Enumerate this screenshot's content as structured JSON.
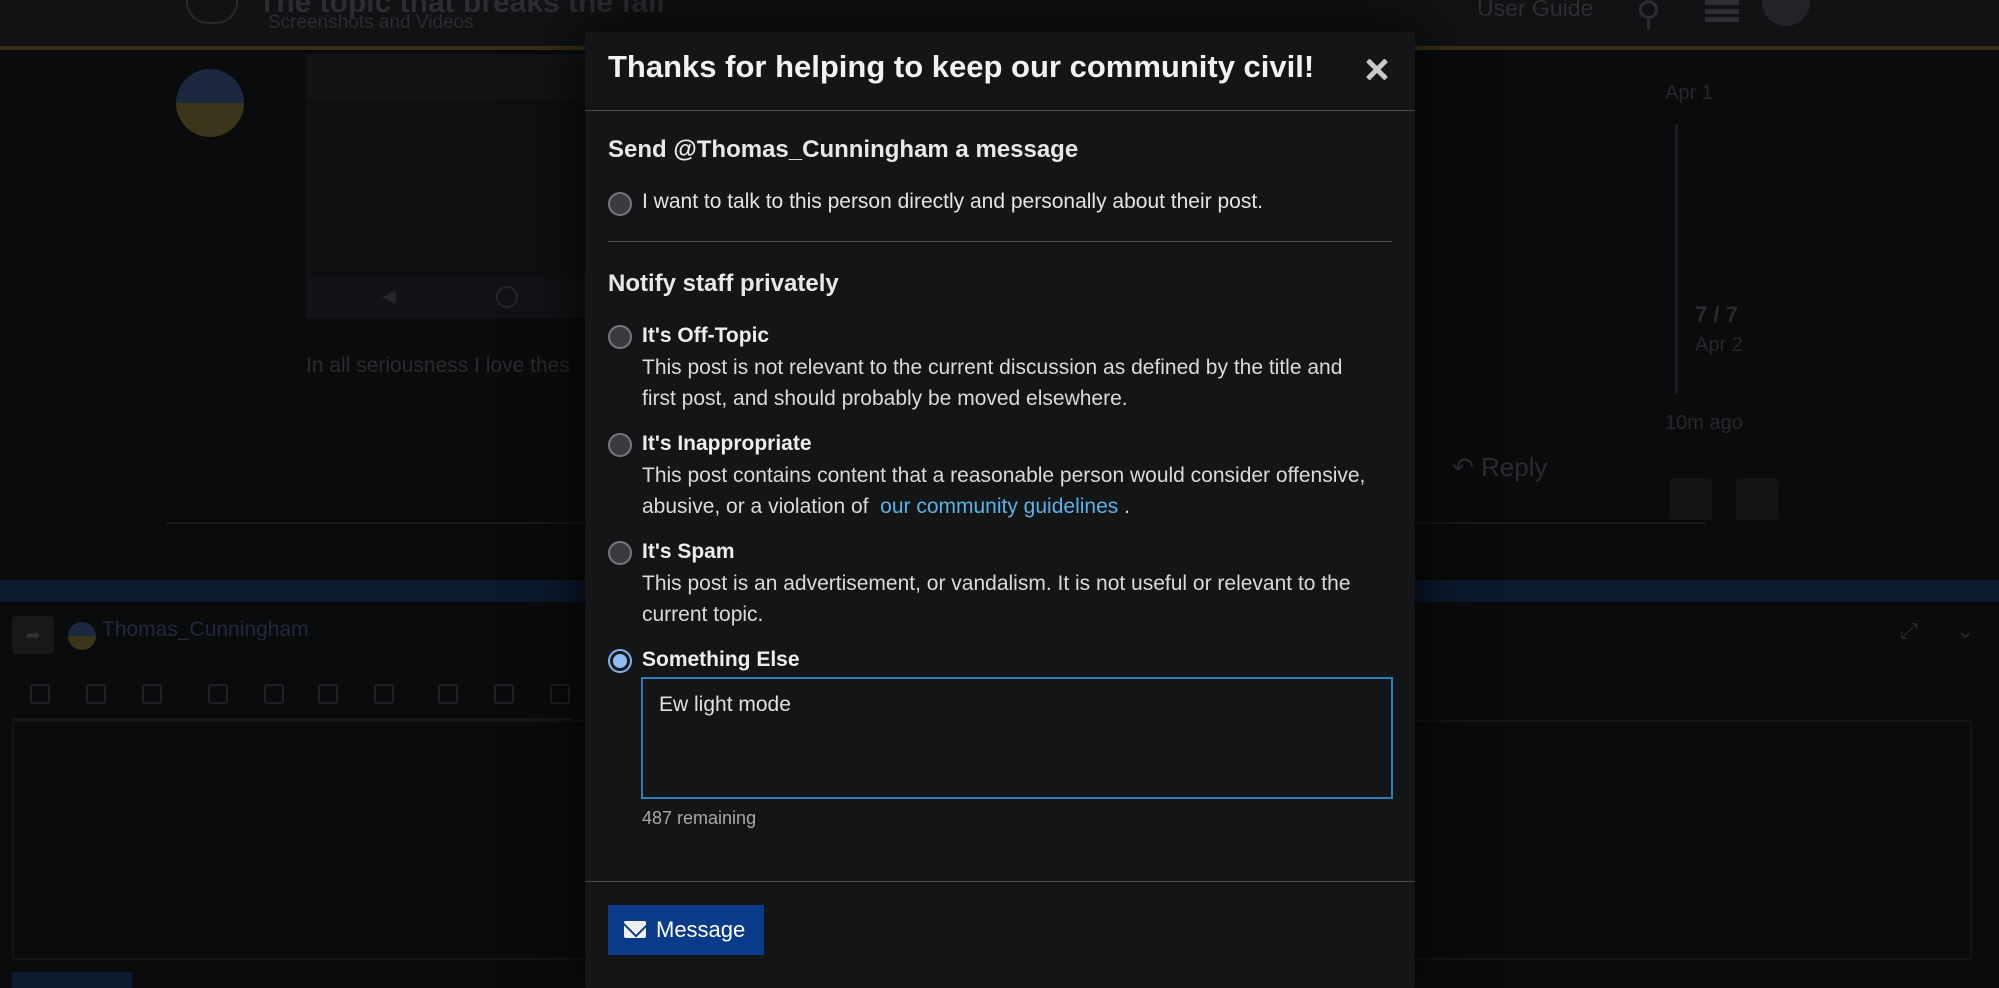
{
  "background": {
    "topic_title": "The topic that breaks the fall",
    "topic_category": "Screenshots and Videos",
    "header": {
      "user_guide": "User Guide"
    },
    "post_text": "In all seriousness I love thes",
    "reply_label": "Reply",
    "timeline": {
      "date_top": "Apr 1",
      "count": "7 / 7",
      "date_bottom": "Apr 2",
      "ago": "10m ago"
    },
    "composer": {
      "username": "Thomas_Cunningham"
    }
  },
  "modal": {
    "title": "Thanks for helping to keep our community civil!",
    "message_section": {
      "heading": "Send @Thomas_Cunningham a message",
      "option_label": "I want to talk to this person directly and personally about their post."
    },
    "staff_section": {
      "heading": "Notify staff privately",
      "options": [
        {
          "title": "It's Off-Topic",
          "desc": "This post is not relevant to the current discussion as defined by the title and first post, and should probably be moved elsewhere."
        },
        {
          "title": "It's Inappropriate",
          "desc": "This post contains content that a reasonable person would consider offensive, abusive, or a violation of",
          "link": "our community guidelines",
          "desc_end": "."
        },
        {
          "title": "It's Spam",
          "desc": "This post is an advertisement, or vandalism. It is not useful or relevant to the current topic."
        },
        {
          "title": "Something Else",
          "selected": true
        }
      ]
    },
    "textarea_value": "Ew light mode",
    "remaining": "487 remaining",
    "submit_label": "Message"
  }
}
